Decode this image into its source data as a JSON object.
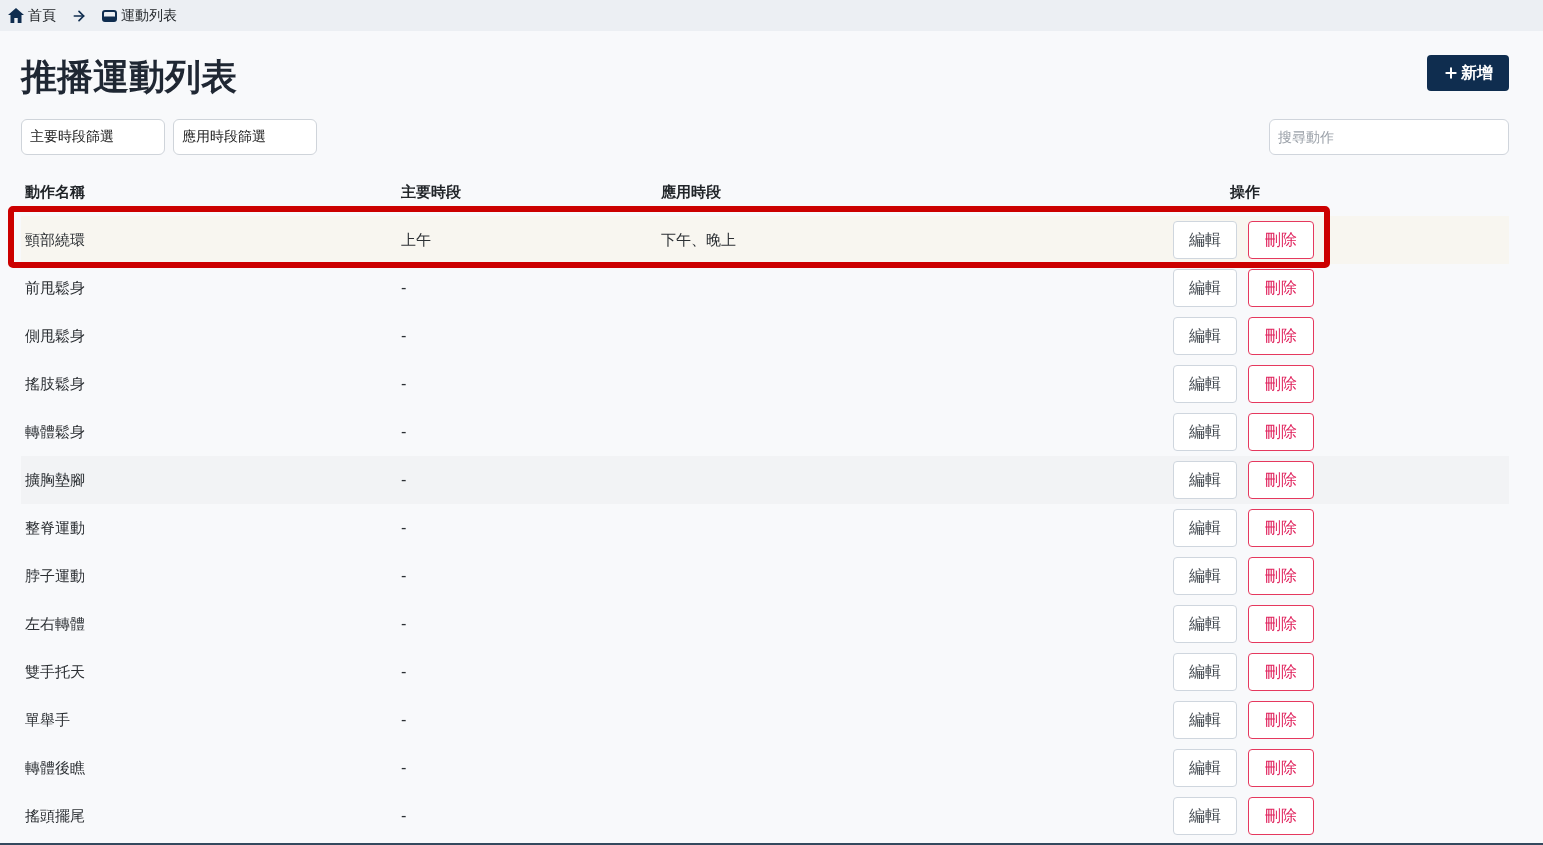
{
  "breadcrumb": [
    {
      "label": "首頁"
    },
    {
      "label": "運動列表"
    }
  ],
  "page_title": "推播運動列表",
  "add_button": {
    "label": "新增"
  },
  "filters": [
    {
      "label": "主要時段篩選"
    },
    {
      "label": "應用時段篩選"
    }
  ],
  "search": {
    "placeholder": "搜尋動作"
  },
  "table": {
    "columns": [
      "動作名稱",
      "主要時段",
      "應用時段",
      "操作"
    ],
    "rows": [
      {
        "name": "頸部繞環",
        "main_period": "上午",
        "applied_period": "下午、晚上",
        "highlighted": true,
        "hovered": false,
        "actions": [
          {
            "kind": "edit",
            "label": "編輯"
          },
          {
            "kind": "delete",
            "label": "刪除"
          }
        ]
      },
      {
        "name": "前甩鬆身",
        "main_period": "-",
        "highlighted": false,
        "hovered": false,
        "actions": [
          {
            "kind": "edit",
            "label": "編輯"
          },
          {
            "kind": "delete",
            "label": "刪除"
          }
        ]
      },
      {
        "name": "側甩鬆身",
        "main_period": "-",
        "highlighted": false,
        "hovered": false,
        "actions": [
          {
            "kind": "edit",
            "label": "編輯"
          },
          {
            "kind": "delete",
            "label": "刪除"
          }
        ]
      },
      {
        "name": "搖肢鬆身",
        "main_period": "-",
        "highlighted": false,
        "hovered": false,
        "actions": [
          {
            "kind": "edit",
            "label": "編輯"
          },
          {
            "kind": "delete",
            "label": "刪除"
          }
        ]
      },
      {
        "name": "轉體鬆身",
        "main_period": "-",
        "highlighted": false,
        "hovered": false,
        "actions": [
          {
            "kind": "edit",
            "label": "編輯"
          },
          {
            "kind": "delete",
            "label": "刪除"
          }
        ]
      },
      {
        "name": "擴胸墊腳",
        "main_period": "-",
        "highlighted": false,
        "hovered": true,
        "actions": [
          {
            "kind": "edit",
            "label": "編輯"
          },
          {
            "kind": "delete",
            "label": "刪除"
          }
        ]
      },
      {
        "name": "整脊運動",
        "main_period": "-",
        "highlighted": false,
        "hovered": false,
        "actions": [
          {
            "kind": "edit",
            "label": "編輯"
          },
          {
            "kind": "delete",
            "label": "刪除"
          }
        ]
      },
      {
        "name": "脖子運動",
        "main_period": "-",
        "highlighted": false,
        "hovered": false,
        "actions": [
          {
            "kind": "edit",
            "label": "編輯"
          },
          {
            "kind": "delete",
            "label": "刪除"
          }
        ]
      },
      {
        "name": "左右轉體",
        "main_period": "-",
        "highlighted": false,
        "hovered": false,
        "actions": [
          {
            "kind": "edit",
            "label": "編輯"
          },
          {
            "kind": "delete",
            "label": "刪除"
          }
        ]
      },
      {
        "name": "雙手托天",
        "main_period": "-",
        "highlighted": false,
        "hovered": false,
        "actions": [
          {
            "kind": "edit",
            "label": "編輯"
          },
          {
            "kind": "delete",
            "label": "刪除"
          }
        ]
      },
      {
        "name": "單舉手",
        "main_period": "-",
        "highlighted": false,
        "hovered": false,
        "actions": [
          {
            "kind": "edit",
            "label": "編輯"
          },
          {
            "kind": "delete",
            "label": "刪除"
          }
        ]
      },
      {
        "name": "轉體後瞧",
        "main_period": "-",
        "highlighted": false,
        "hovered": false,
        "actions": [
          {
            "kind": "edit",
            "label": "編輯"
          },
          {
            "kind": "delete",
            "label": "刪除"
          }
        ]
      },
      {
        "name": "搖頭擺尾",
        "main_period": "-",
        "highlighted": false,
        "hovered": false,
        "actions": [
          {
            "kind": "edit",
            "label": "編輯"
          },
          {
            "kind": "delete",
            "label": "刪除"
          }
        ]
      }
    ]
  }
}
